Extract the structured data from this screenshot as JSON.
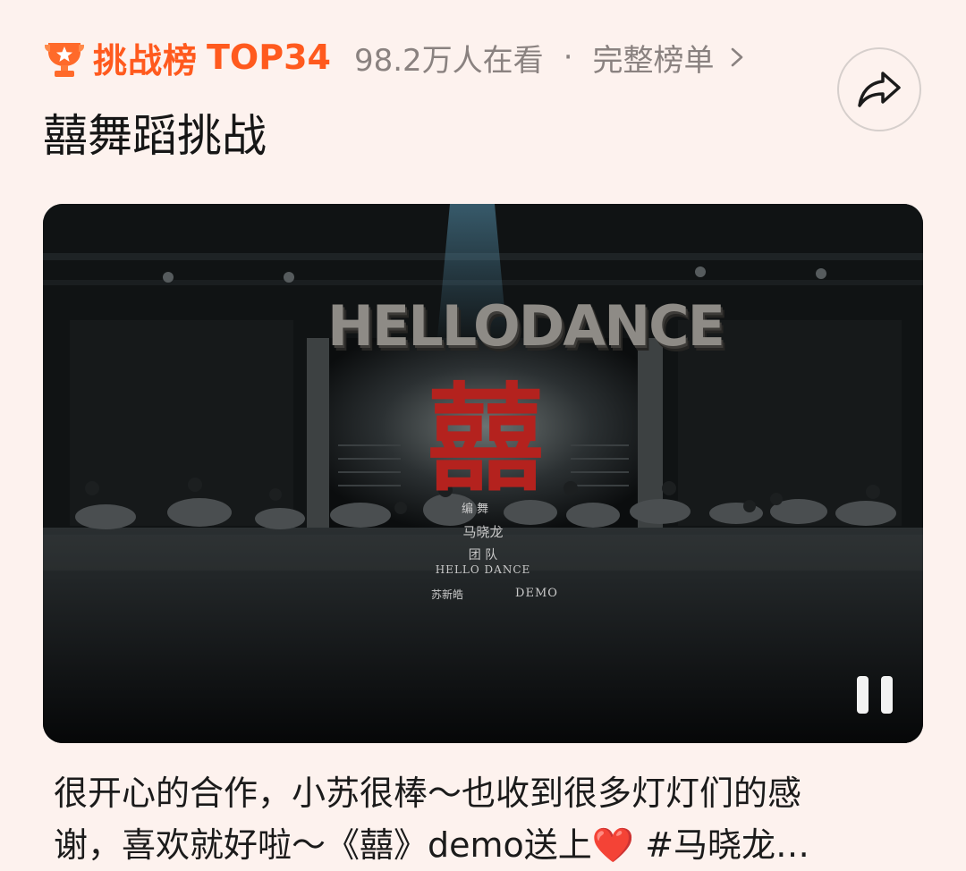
{
  "header": {
    "rank_name": "挑战榜",
    "rank_position": "TOP34",
    "viewers": "98.2万人在看",
    "separator": "·",
    "full_list_label": "完整榜单",
    "accent_color": "#ff5a1e"
  },
  "title": "囍舞蹈挑战",
  "video": {
    "overlay_title": "HELLODANCE",
    "big_char": "囍",
    "credit_role": "编  舞",
    "credit_name": "马晓龙",
    "team_label": "团 队",
    "team_name": "HELLO DANCE",
    "dancer": "苏新皓",
    "demo": "DEMO",
    "state": "playing"
  },
  "caption": {
    "line1": "很开心的合作，小苏很棒～也收到很多灯灯们的感",
    "line2_before_heart": "谢，喜欢就好啦～《囍》demo送上",
    "heart": "❤️",
    "line2_after_heart": " #马晓龙…"
  },
  "icons": {
    "trophy": "trophy-icon",
    "chevron": "chevron-right-icon",
    "share": "share-icon",
    "pause": "pause-icon"
  }
}
